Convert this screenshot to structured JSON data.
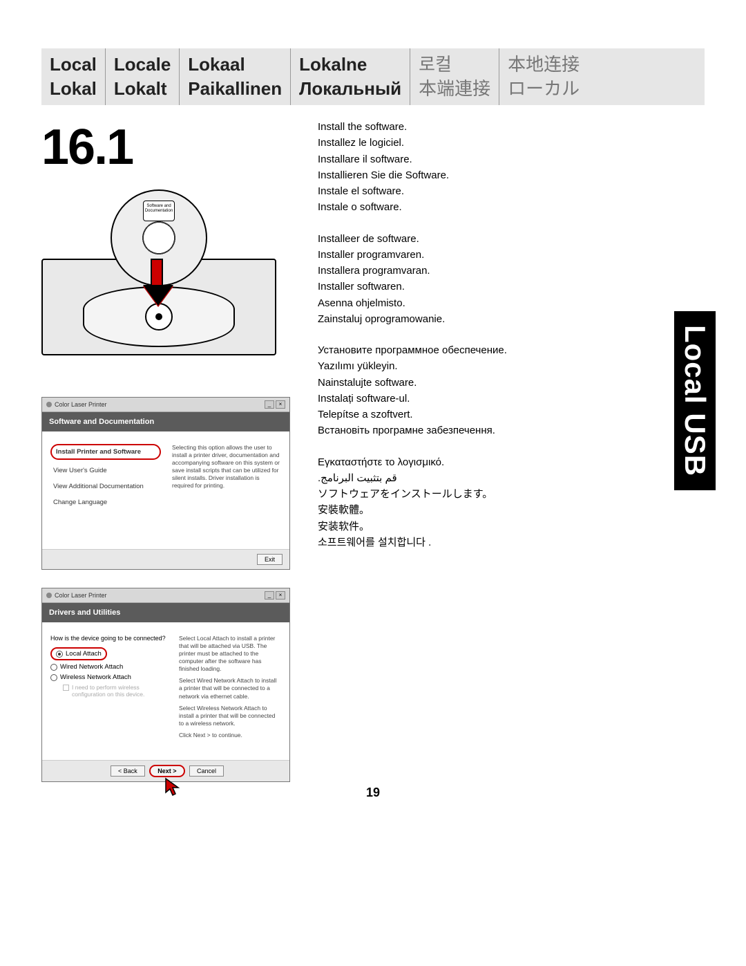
{
  "header": {
    "cols": [
      {
        "row1": "Local",
        "row2": "Lokal"
      },
      {
        "row1": "Locale",
        "row2": "Lokalt"
      },
      {
        "row1": "Lokaal",
        "row2": "Paikallinen"
      },
      {
        "row1": "Lokalne",
        "row2": "Локальный"
      },
      {
        "row1": "로컬",
        "row2": "本端連接",
        "cjk": true
      },
      {
        "row1": "本地连接",
        "row2": "ローカル",
        "cjk": true
      }
    ]
  },
  "step_number": "16.1",
  "cd_label": "Software and Documentation",
  "installer1": {
    "window_title": "Color Laser Printer",
    "banner": "Software and Documentation",
    "menu": {
      "primary": "Install Printer and Software",
      "items": [
        "View User's Guide",
        "View Additional Documentation",
        "Change Language"
      ]
    },
    "description": "Selecting this option allows the user to install a printer driver, documentation and accompanying software on this system or save install scripts that can be utilized for silent installs. Driver installation is required for printing.",
    "exit_label": "Exit"
  },
  "installer2": {
    "window_title": "Color Laser Printer",
    "banner": "Drivers and Utilities",
    "question": "How is the device going to be connected?",
    "options": {
      "local": "Local Attach",
      "wired": "Wired Network Attach",
      "wireless": "Wireless Network Attach"
    },
    "checkbox_note": "I need to perform wireless configuration on this device.",
    "side_text": {
      "p1": "Select Local Attach to install a printer that will be attached via USB. The printer must be attached to the computer after the software has finished loading.",
      "p2": "Select Wired Network Attach to install a printer that will be connected to a network via ethernet cable.",
      "p3": "Select Wireless Network Attach to install a printer that will be connected to a wireless network.",
      "p4": "Click Next > to continue."
    },
    "buttons": {
      "back": "< Back",
      "next": "Next >",
      "cancel": "Cancel"
    }
  },
  "instructions": {
    "group1": [
      "Install the software.",
      "Installez le logiciel.",
      "Installare il software.",
      "Installieren Sie die Software.",
      "Instale el software.",
      "Instale o software."
    ],
    "group2": [
      "Installeer de software.",
      "Installer programvaren.",
      "Installera programvaran.",
      "Installer softwaren.",
      "Asenna ohjelmisto.",
      "Zainstaluj oprogramowanie."
    ],
    "group3": [
      "Установите программное обеспечение.",
      "Yazılımı yükleyin.",
      "Nainstalujte software.",
      "Instalați software-ul.",
      "Telepítse a szoftvert.",
      "Встановіть програмне забезпечення."
    ],
    "group4": [
      "Εγκαταστήστε το λογισμικό.",
      "قم بتثبيت البرنامج.",
      "ソフトウェアをインストールします。",
      "安裝軟體。",
      "安装软件。",
      "소프트웨어를 설치합니다 ."
    ]
  },
  "side_tab": "Local USB",
  "page_number": "19"
}
